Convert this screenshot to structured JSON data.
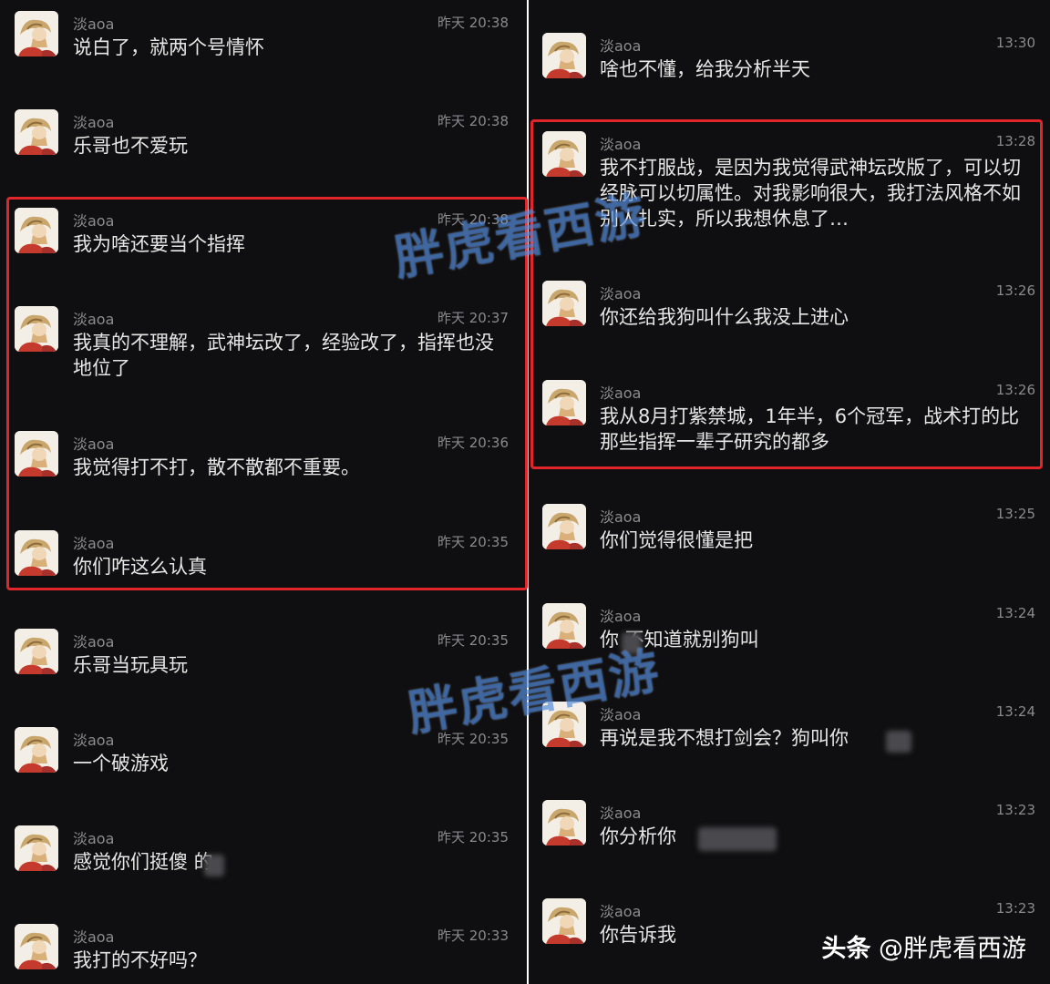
{
  "left_messages": [
    {
      "user": "淡aoa",
      "time": "昨天 20:38",
      "text": "说白了，就两个号情怀"
    },
    {
      "user": "淡aoa",
      "time": "昨天 20:38",
      "text": "乐哥也不爱玩"
    },
    {
      "user": "淡aoa",
      "time": "昨天 20:38",
      "text": "我为啥还要当个指挥"
    },
    {
      "user": "淡aoa",
      "time": "昨天 20:37",
      "text": "我真的不理解，武神坛改了，经验改了，指挥也没地位了"
    },
    {
      "user": "淡aoa",
      "time": "昨天 20:36",
      "text": "我觉得打不打，散不散都不重要。"
    },
    {
      "user": "淡aoa",
      "time": "昨天 20:35",
      "text": "你们咋这么认真"
    },
    {
      "user": "淡aoa",
      "time": "昨天 20:35",
      "text": "乐哥当玩具玩"
    },
    {
      "user": "淡aoa",
      "time": "昨天 20:35",
      "text": "一个破游戏"
    },
    {
      "user": "淡aoa",
      "time": "昨天 20:35",
      "text": "感觉你们挺傻 的"
    },
    {
      "user": "淡aoa",
      "time": "昨天 20:33",
      "text": "我打的不好吗？"
    }
  ],
  "right_messages": [
    {
      "user": "淡aoa",
      "time": "13:30",
      "text": "啥也不懂，给我分析半天"
    },
    {
      "user": "淡aoa",
      "time": "13:28",
      "text": "我不打服战，是因为我觉得武神坛改版了，可以切经脉可以切属性。对我影响很大，我打法风格不如别人扎实，所以我想休息了…"
    },
    {
      "user": "淡aoa",
      "time": "13:26",
      "text": "你还给我狗叫什么我没上进心"
    },
    {
      "user": "淡aoa",
      "time": "13:26",
      "text": "我从8月打紫禁城，1年半，6个冠军，战术打的比那些指挥一辈子研究的都多"
    },
    {
      "user": "淡aoa",
      "time": "13:25",
      "text": "你们觉得很懂是把"
    },
    {
      "user": "淡aoa",
      "time": "13:24",
      "text": "你 不知道就别狗叫"
    },
    {
      "user": "淡aoa",
      "time": "13:24",
      "text": "再说是我不想打剑会？狗叫你"
    },
    {
      "user": "淡aoa",
      "time": "13:23",
      "text": "你分析你"
    },
    {
      "user": "淡aoa",
      "time": "13:23",
      "text": "你告诉我"
    }
  ],
  "watermark_text": "胖虎看西游",
  "footer": {
    "brand": "头条",
    "handle": "@胖虎看西游"
  },
  "colors": {
    "highlight": "#e0262a",
    "watermark": "#286ed2",
    "background": "#0f0f11"
  }
}
